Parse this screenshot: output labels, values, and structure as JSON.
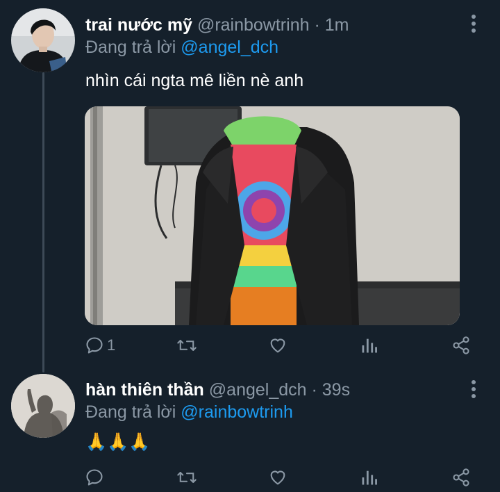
{
  "tweets": [
    {
      "name": "trai nước mỹ",
      "handle": "@rainbowtrinh",
      "time": "1m",
      "separator": "·",
      "reply_prefix": "Đang trả lời",
      "reply_to": "@angel_dch",
      "text": "nhìn cái ngta mê liền nè anh",
      "has_media": true,
      "reply_count": "1"
    },
    {
      "name": "hàn thiên thần",
      "handle": "@angel_dch",
      "time": "39s",
      "separator": "·",
      "reply_prefix": "Đang trả lời",
      "reply_to": "@rainbowtrinh",
      "text": "🙏🙏🙏",
      "has_media": false,
      "reply_count": ""
    }
  ],
  "icons": {
    "reply": "reply-icon",
    "retweet": "retweet-icon",
    "like": "heart-icon",
    "analytics": "analytics-icon",
    "share": "share-icon",
    "more": "more-vertical-icon"
  },
  "colors": {
    "background": "#15202b",
    "secondary_text": "#8b98a5",
    "accent": "#1d9bf0"
  }
}
